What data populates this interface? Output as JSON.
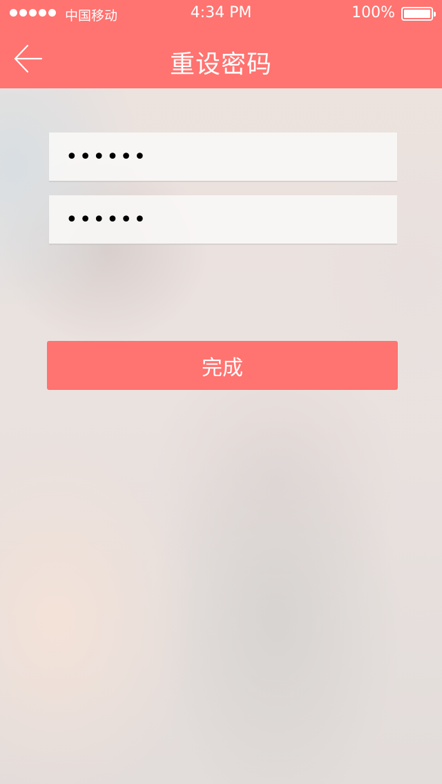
{
  "status_bar": {
    "carrier": "中国移动",
    "time": "4:34 PM",
    "battery_percent": "100%",
    "signal_dots": 5
  },
  "nav": {
    "title": "重设密码",
    "back_icon": "arrow-left-icon"
  },
  "form": {
    "new_password_value": "••••••",
    "confirm_password_value": "••••••",
    "submit_label": "完成"
  },
  "colors": {
    "accent": "#ff7370"
  }
}
